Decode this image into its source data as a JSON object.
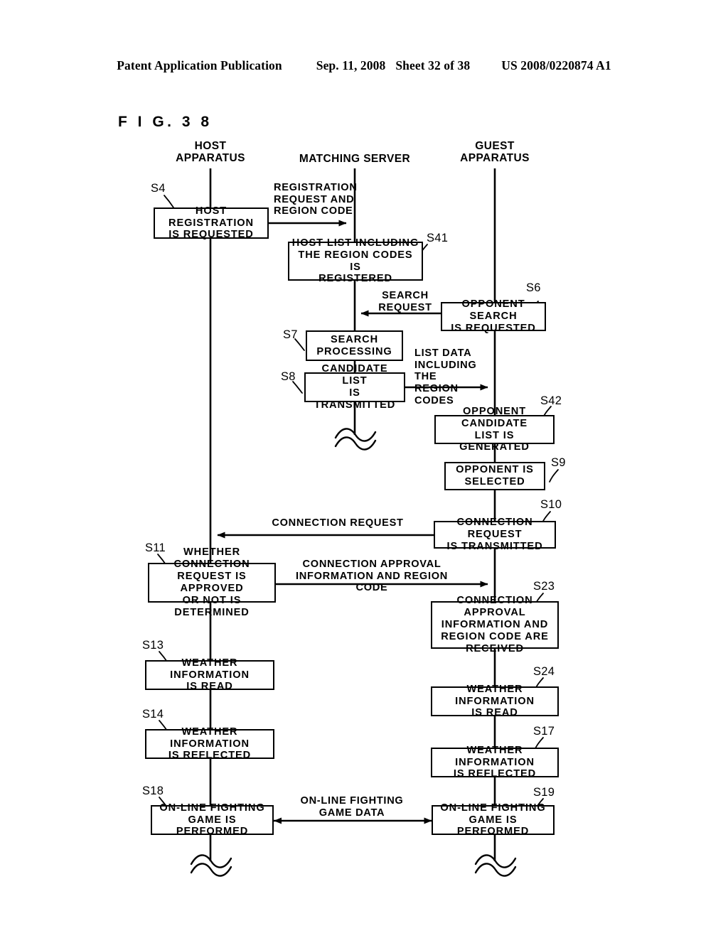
{
  "header": {
    "publication": "Patent Application Publication",
    "date": "Sep. 11, 2008",
    "sheet": "Sheet 32 of 38",
    "doc_number": "US 2008/0220874 A1"
  },
  "figure": {
    "label": "F I G.  3 8"
  },
  "lanes": [
    {
      "id": "host",
      "title": "HOST\nAPPARATUS"
    },
    {
      "id": "server",
      "title": "MATCHING SERVER"
    },
    {
      "id": "guest",
      "title": "GUEST\nAPPARATUS"
    }
  ],
  "steps": [
    {
      "ref": "S4",
      "lane": "host",
      "text": "HOST REGISTRATION\nIS REQUESTED"
    },
    {
      "ref": "S41",
      "lane": "server",
      "text": "HOST LIST INCLUDING\nTHE REGION CODES IS\nREGISTERED"
    },
    {
      "ref": "S6",
      "lane": "guest",
      "text": "OPPONENT SEARCH\nIS REQUESTED"
    },
    {
      "ref": "S7",
      "lane": "server",
      "text": "SEARCH\nPROCESSING"
    },
    {
      "ref": "S8",
      "lane": "server",
      "text": "CANDIDATE LIST\nIS TRANSMITTED"
    },
    {
      "ref": "S42",
      "lane": "guest",
      "text": "OPPONENT CANDIDATE\nLIST IS GENERATED"
    },
    {
      "ref": "S9",
      "lane": "guest",
      "text": "OPPONENT IS\nSELECTED"
    },
    {
      "ref": "S10",
      "lane": "guest",
      "text": "CONNECTION REQUEST\nIS TRANSMITTED"
    },
    {
      "ref": "S11",
      "lane": "host",
      "text": "WHETHER CONNECTION\nREQUEST IS APPROVED\nOR NOT IS DETERMINED"
    },
    {
      "ref": "S23",
      "lane": "guest",
      "text": "CONNECTION APPROVAL\nINFORMATION AND\nREGION CODE ARE\nRECEIVED"
    },
    {
      "ref": "S13",
      "lane": "host",
      "text": "WEATHER INFORMATION\nIS READ"
    },
    {
      "ref": "S24",
      "lane": "guest",
      "text": "WEATHER INFORMATION\nIS READ"
    },
    {
      "ref": "S14",
      "lane": "host",
      "text": "WEATHER INFORMATION\nIS REFLECTED"
    },
    {
      "ref": "S17",
      "lane": "guest",
      "text": "WEATHER INFORMATION\nIS REFLECTED"
    },
    {
      "ref": "S18",
      "lane": "host",
      "text": "ON-LINE  FIGHTING\nGAME IS PERFORMED"
    },
    {
      "ref": "S19",
      "lane": "guest",
      "text": "ON-LINE  FIGHTING\nGAME IS PERFORMED"
    }
  ],
  "messages": [
    {
      "id": "registration-request",
      "text": "REGISTRATION\nREQUEST AND\nREGION CODE",
      "from": "host",
      "to": "server"
    },
    {
      "id": "search-request",
      "text": "SEARCH\nREQUEST",
      "from": "guest",
      "to": "server"
    },
    {
      "id": "list-data",
      "text": "LIST DATA\nINCLUDING THE\nREGION CODES",
      "from": "server",
      "to": "guest"
    },
    {
      "id": "connection-request",
      "text": "CONNECTION REQUEST",
      "from": "guest",
      "to": "host"
    },
    {
      "id": "connection-approval",
      "text": "CONNECTION APPROVAL\nINFORMATION AND REGION CODE",
      "from": "host",
      "to": "guest"
    },
    {
      "id": "game-data",
      "text": "ON-LINE FIGHTING\nGAME DATA",
      "from": "both",
      "to": "both"
    }
  ]
}
